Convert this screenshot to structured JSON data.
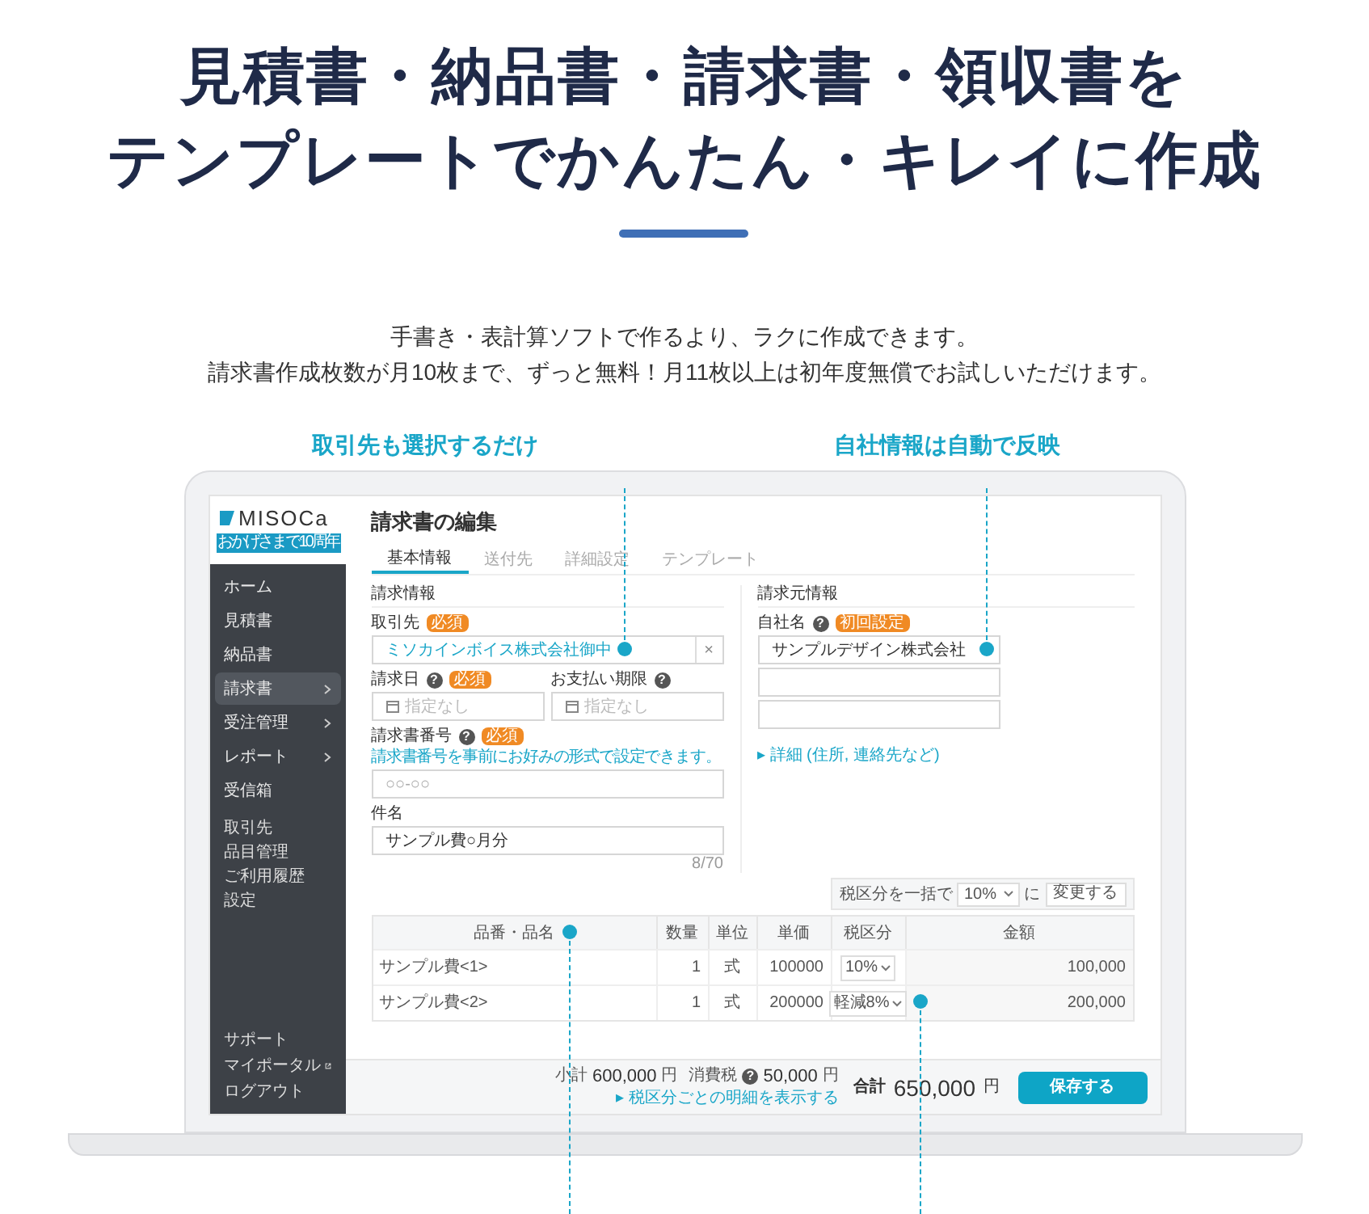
{
  "headline": [
    "見積書・納品書・請求書・領収書を",
    "テンプレートでかんたん・キレイに作成"
  ],
  "intro": [
    "手書き・表計算ソフトで作るより、ラクに作成できます。",
    "請求書作成枚数が月10枚まで、ずっと無料！月11枚以上は初年度無償でお試しいただけます。"
  ],
  "callouts": [
    "取引先も選択するだけ",
    "自社情報は自動で反映"
  ],
  "app": {
    "logo": {
      "name": "MISOCa",
      "tagline": "おかげさまで10周年"
    },
    "sidebar": {
      "main": [
        {
          "label": "ホーム",
          "selected": false,
          "expandable": false
        },
        {
          "label": "見積書",
          "selected": false,
          "expandable": false
        },
        {
          "label": "納品書",
          "selected": false,
          "expandable": false
        },
        {
          "label": "請求書",
          "selected": true,
          "expandable": true
        },
        {
          "label": "受注管理",
          "selected": false,
          "expandable": true
        },
        {
          "label": "レポート",
          "selected": false,
          "expandable": true
        },
        {
          "label": "受信箱",
          "selected": false,
          "expandable": false
        }
      ],
      "sub": [
        "取引先",
        "品目管理",
        "ご利用履歴",
        "設定"
      ],
      "bottom": [
        {
          "label": "サポート",
          "external": false
        },
        {
          "label": "マイポータル",
          "external": true
        },
        {
          "label": "ログアウト",
          "external": false
        }
      ]
    },
    "title": "請求書の編集",
    "tabs": [
      {
        "label": "基本情報",
        "selected": true
      },
      {
        "label": "送付先",
        "selected": false
      },
      {
        "label": "詳細設定",
        "selected": false
      },
      {
        "label": "テンプレート",
        "selected": false
      }
    ],
    "billing": {
      "heading": "請求情報",
      "client": {
        "label": "取引先",
        "badge": "必須",
        "value": "ミソカインボイス株式会社御中",
        "clear": "×"
      },
      "date": {
        "label": "請求日",
        "help": "?",
        "badge": "必須",
        "placeholder": "指定なし"
      },
      "due": {
        "label": "お支払い期限",
        "help": "?",
        "placeholder": "指定なし"
      },
      "number": {
        "label": "請求書番号",
        "help": "?",
        "badge": "必須",
        "hint": "請求書番号を事前にお好みの形式で設定できます。",
        "placeholder": "○○-○○"
      },
      "subject": {
        "label": "件名",
        "value": "サンプル費○月分",
        "counter": "8/70"
      }
    },
    "issuer": {
      "heading": "請求元情報",
      "label": "自社名",
      "help": "?",
      "badge": "初回設定",
      "value": "サンプルデザイン株式会社",
      "details": "▸ 詳細 (住所, 連絡先など)"
    },
    "bulk_tax": {
      "label": "税区分を一括で",
      "value": "10%",
      "suffix": "に",
      "button": "変更する"
    },
    "table": {
      "columns": [
        "品番・品名",
        "数量",
        "単位",
        "単価",
        "税区分",
        "金額"
      ],
      "rows": [
        [
          "サンプル費<1>",
          "1",
          "式",
          "100000",
          "10%",
          "100,000"
        ],
        [
          "サンプル費<2>",
          "1",
          "式",
          "200000",
          "軽減8%",
          "200,000"
        ]
      ]
    },
    "footer": {
      "subtotal_label": "小計",
      "subtotal": "600,000",
      "subtotal_currency": "円",
      "tax_label": "消費税",
      "tax_help": "?",
      "tax": "50,000",
      "tax_currency": "円",
      "breakdown": "▸ 税区分ごとの明細を表示する",
      "total_label": "合計",
      "total": "650,000",
      "total_currency": "円",
      "save": "保存する"
    }
  }
}
